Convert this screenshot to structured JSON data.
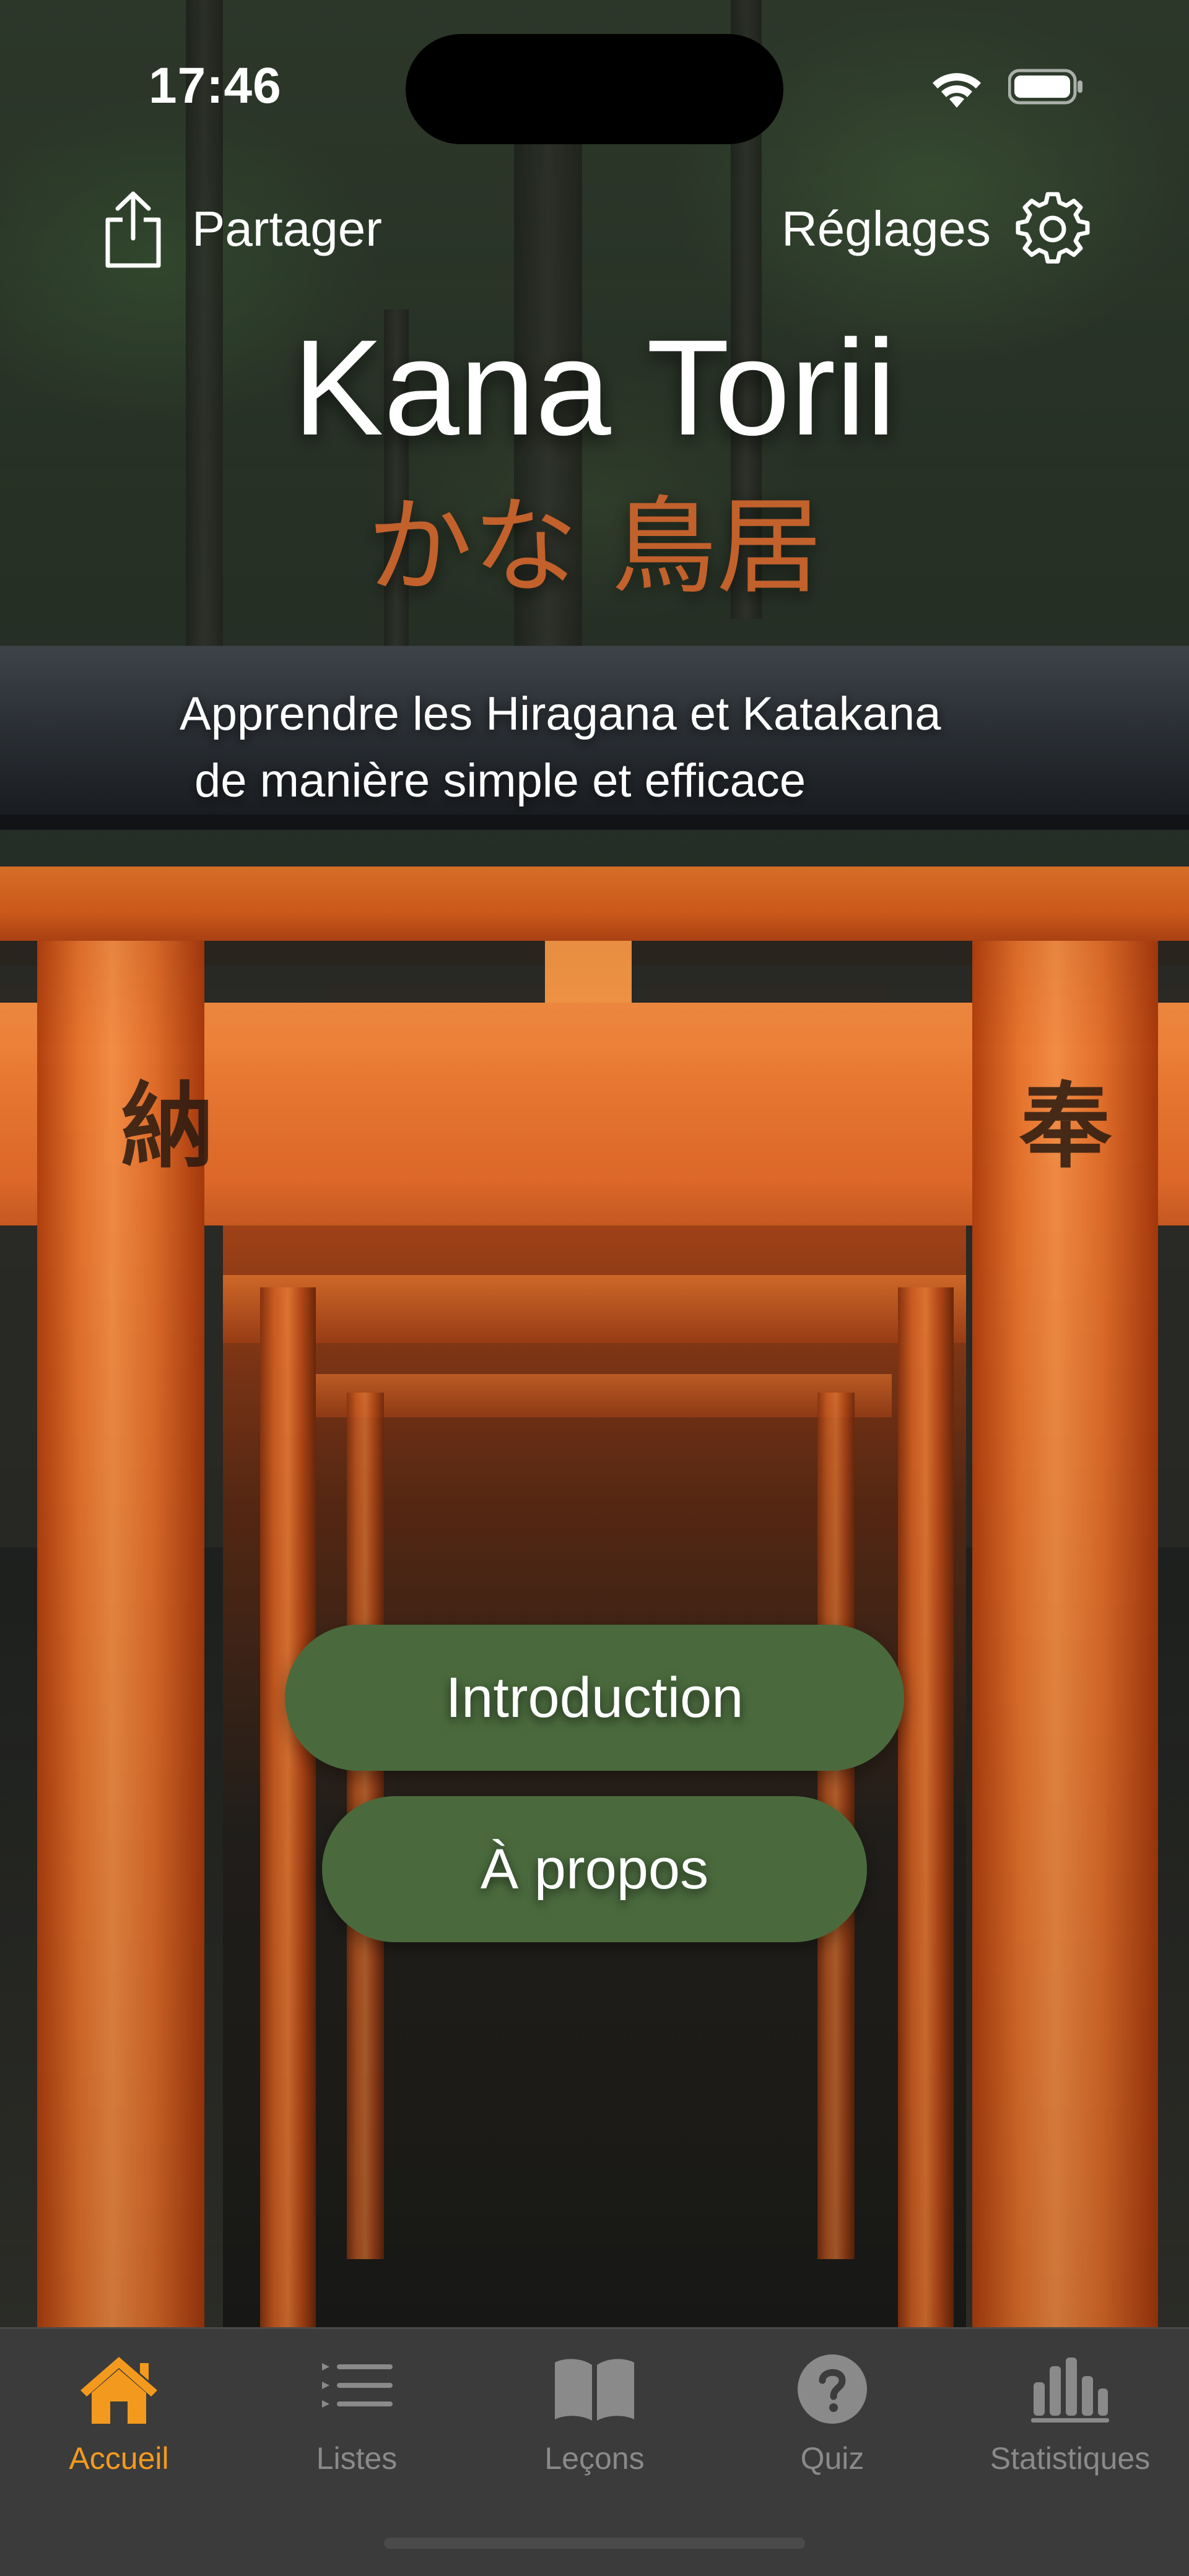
{
  "status_bar": {
    "time": "17:46"
  },
  "top_actions": {
    "share_label": "Partager",
    "settings_label": "Réglages"
  },
  "header": {
    "title": "Kana Torii",
    "subtitle_jp": "かな 鳥居",
    "tagline_line1": "Apprendre les Hiragana et Katakana",
    "tagline_line2": "de manière simple et efficace"
  },
  "background": {
    "pillar_kanji_left": "納",
    "pillar_kanji_right": "奉"
  },
  "actions": {
    "introduction_label": "Introduction",
    "about_label": "À propos"
  },
  "tabbar": {
    "items": [
      {
        "label": "Accueil",
        "icon": "house-icon",
        "active": true
      },
      {
        "label": "Listes",
        "icon": "list-icon",
        "active": false
      },
      {
        "label": "Leçons",
        "icon": "book-icon",
        "active": false
      },
      {
        "label": "Quiz",
        "icon": "question-icon",
        "active": false
      },
      {
        "label": "Statistiques",
        "icon": "chart-icon",
        "active": false
      }
    ]
  },
  "colors": {
    "accent": "#f39a1e",
    "button": "#4a6a3d",
    "subtitle": "#c2612c",
    "tabbar_bg": "#3c3c3c",
    "inactive_tab": "#8a8a8a"
  }
}
